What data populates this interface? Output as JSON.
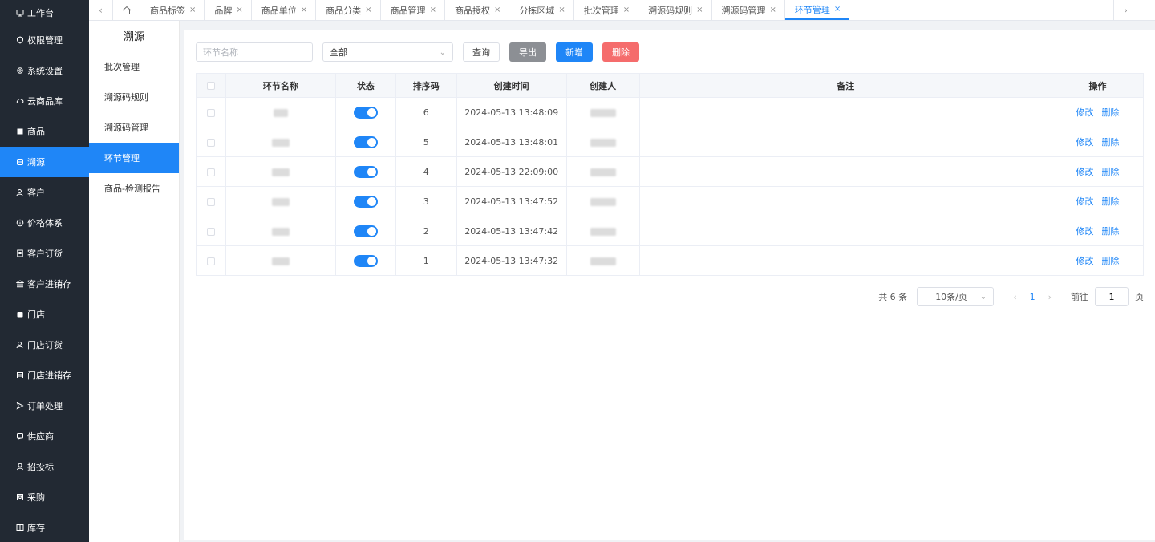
{
  "sidebar": {
    "items": [
      {
        "label": "工作台",
        "icon": "monitor-icon",
        "active": false
      },
      {
        "label": "权限管理",
        "icon": "shield-icon",
        "active": false
      },
      {
        "label": "系统设置",
        "icon": "gear-icon",
        "active": false
      },
      {
        "label": "云商品库",
        "icon": "cloud-icon",
        "active": false
      },
      {
        "label": "商品",
        "icon": "box-icon",
        "active": false
      },
      {
        "label": "溯源",
        "icon": "trace-icon",
        "active": true
      },
      {
        "label": "客户",
        "icon": "user-icon",
        "active": false
      },
      {
        "label": "价格体系",
        "icon": "info-icon",
        "active": false
      },
      {
        "label": "客户订货",
        "icon": "order-icon",
        "active": false
      },
      {
        "label": "客户进销存",
        "icon": "bank-icon",
        "active": false
      },
      {
        "label": "门店",
        "icon": "store-icon",
        "active": false
      },
      {
        "label": "门店订货",
        "icon": "user-icon",
        "active": false
      },
      {
        "label": "门店进销存",
        "icon": "list-icon",
        "active": false
      },
      {
        "label": "订单处理",
        "icon": "send-icon",
        "active": false
      },
      {
        "label": "供应商",
        "icon": "chat-icon",
        "active": false
      },
      {
        "label": "招投标",
        "icon": "person-icon",
        "active": false
      },
      {
        "label": "采购",
        "icon": "cart-icon",
        "active": false
      },
      {
        "label": "库存",
        "icon": "book-icon",
        "active": false
      }
    ]
  },
  "tabs": {
    "items": [
      {
        "label": "商品标签",
        "active": false
      },
      {
        "label": "品牌",
        "active": false
      },
      {
        "label": "商品单位",
        "active": false
      },
      {
        "label": "商品分类",
        "active": false
      },
      {
        "label": "商品管理",
        "active": false
      },
      {
        "label": "商品授权",
        "active": false
      },
      {
        "label": "分拣区域",
        "active": false
      },
      {
        "label": "批次管理",
        "active": false
      },
      {
        "label": "溯源码规则",
        "active": false
      },
      {
        "label": "溯源码管理",
        "active": false
      },
      {
        "label": "环节管理",
        "active": true
      }
    ],
    "close_glyph": "×",
    "left_arrow": "‹",
    "right_arrow": "›"
  },
  "subside": {
    "title": "溯源",
    "items": [
      {
        "label": "批次管理",
        "active": false
      },
      {
        "label": "溯源码规则",
        "active": false
      },
      {
        "label": "溯源码管理",
        "active": false
      },
      {
        "label": "环节管理",
        "active": true
      },
      {
        "label": "商品-检测报告",
        "active": false
      }
    ]
  },
  "toolbar": {
    "search_placeholder": "环节名称",
    "select_value": "全部",
    "query_label": "查询",
    "export_label": "导出",
    "add_label": "新增",
    "delete_label": "删除"
  },
  "table": {
    "headers": {
      "name": "环节名称",
      "status": "状态",
      "sort": "排序码",
      "created": "创建时间",
      "creator": "创建人",
      "remark": "备注",
      "actions": "操作"
    },
    "rows": [
      {
        "sort": "6",
        "created": "2024-05-13 13:48:09",
        "status_on": true
      },
      {
        "sort": "5",
        "created": "2024-05-13 13:48:01",
        "status_on": true
      },
      {
        "sort": "4",
        "created": "2024-05-13 22:09:00",
        "status_on": true
      },
      {
        "sort": "3",
        "created": "2024-05-13 13:47:52",
        "status_on": true
      },
      {
        "sort": "2",
        "created": "2024-05-13 13:47:42",
        "status_on": true
      },
      {
        "sort": "1",
        "created": "2024-05-13 13:47:32",
        "status_on": true
      }
    ],
    "edit_label": "修改",
    "delete_label": "删除"
  },
  "pagination": {
    "total": "共 6 条",
    "page_size": "10条/页",
    "current_page": "1",
    "goto_label": "前往",
    "goto_value": "1",
    "suffix": "页",
    "prev": "‹",
    "next": "›"
  },
  "colors": {
    "primary": "#1f86f7",
    "sidebar_bg": "#222933",
    "danger": "#f56c6c",
    "export_gray": "#8c8f94"
  }
}
